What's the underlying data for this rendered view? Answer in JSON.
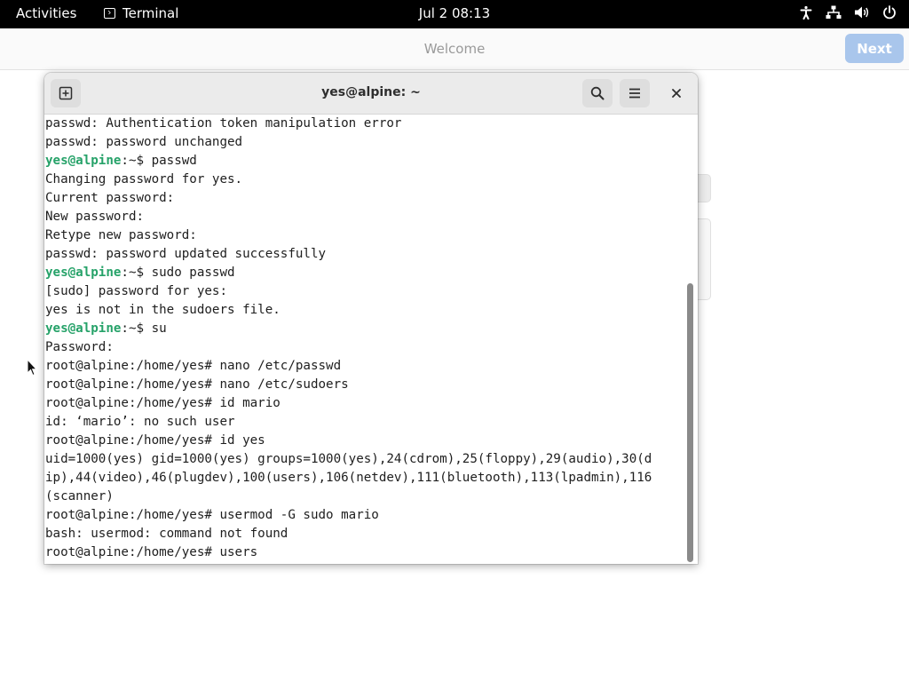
{
  "topbar": {
    "activities": "Activities",
    "app_name": "Terminal",
    "clock": "Jul 2  08:13",
    "tray_icons": [
      "accessibility-icon",
      "network-icon",
      "volume-icon",
      "power-icon"
    ]
  },
  "welcome": {
    "title": "Welcome",
    "next_label": "Next"
  },
  "terminal": {
    "title": "yes@alpine: ~",
    "prompt_user_host": "yes@alpine",
    "lines": [
      {
        "text": "passwd: Authentication token manipulation error"
      },
      {
        "text": "passwd: password unchanged"
      },
      {
        "prompt": "yes@alpine",
        "text": ":~$ passwd"
      },
      {
        "text": "Changing password for yes."
      },
      {
        "text": "Current password:"
      },
      {
        "text": "New password:"
      },
      {
        "text": "Retype new password:"
      },
      {
        "text": "passwd: password updated successfully"
      },
      {
        "prompt": "yes@alpine",
        "text": ":~$ sudo passwd"
      },
      {
        "text": "[sudo] password for yes:"
      },
      {
        "text": "yes is not in the sudoers file."
      },
      {
        "prompt": "yes@alpine",
        "text": ":~$ su"
      },
      {
        "text": "Password:"
      },
      {
        "text": "root@alpine:/home/yes# nano /etc/passwd"
      },
      {
        "text": "root@alpine:/home/yes# nano /etc/sudoers"
      },
      {
        "text": "root@alpine:/home/yes# id mario"
      },
      {
        "text": "id: ‘mario’: no such user"
      },
      {
        "text": "root@alpine:/home/yes# id yes"
      },
      {
        "text": "uid=1000(yes) gid=1000(yes) groups=1000(yes),24(cdrom),25(floppy),29(audio),30(d"
      },
      {
        "text": "ip),44(video),46(plugdev),100(users),106(netdev),111(bluetooth),113(lpadmin),116"
      },
      {
        "text": "(scanner)"
      },
      {
        "text": "root@alpine:/home/yes# usermod -G sudo mario"
      },
      {
        "text": "bash: usermod: command not found"
      },
      {
        "text": "root@alpine:/home/yes# users"
      }
    ]
  },
  "colors": {
    "prompt_green": "#26a269",
    "next_button": "#a9c6ec",
    "topbar": "#000000"
  }
}
